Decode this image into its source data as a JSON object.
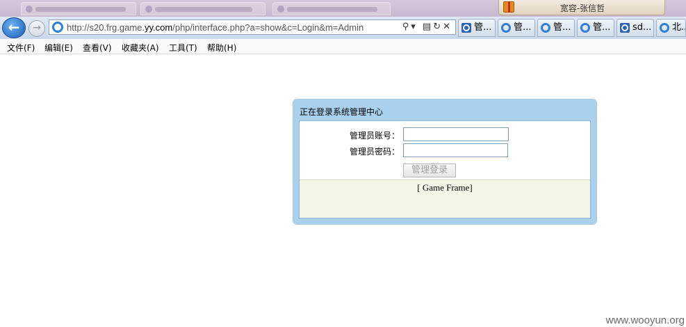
{
  "browser": {
    "owner_name": "宽容-张信哲",
    "address_url_prefix": "http://s20.frg.game.",
    "address_url_domain": "yy.com",
    "address_url_suffix": "/php/interface.php?a=show&c=Login&m=Admin",
    "address_icons": "⚲▾ ▤↻✕",
    "tabs": [
      {
        "label": "管...",
        "icon": "search-icon"
      },
      {
        "label": "管...",
        "icon": "ie-icon"
      },
      {
        "label": "管...",
        "icon": "ie-icon"
      },
      {
        "label": "管...",
        "icon": "ie-icon"
      },
      {
        "label": "sd...",
        "icon": "search-icon"
      },
      {
        "label": "北...",
        "icon": "ie-icon"
      }
    ],
    "menu": [
      "文件(F)",
      "编辑(E)",
      "查看(V)",
      "收藏夹(A)",
      "工具(T)",
      "帮助(H)"
    ]
  },
  "login": {
    "title": "正在登录系统管理中心",
    "account_label": "管理员账号：",
    "account_value": "",
    "password_label": "管理员密码：",
    "password_value": "",
    "submit_label": "管理登录",
    "footer_link": "[ Game Frame]"
  },
  "watermark": "www.wooyun.org",
  "colors": {
    "panel_bg": "#a9d0ec",
    "footer_bg": "#f5f5e8",
    "nav_bg": "#c8d7ea"
  }
}
